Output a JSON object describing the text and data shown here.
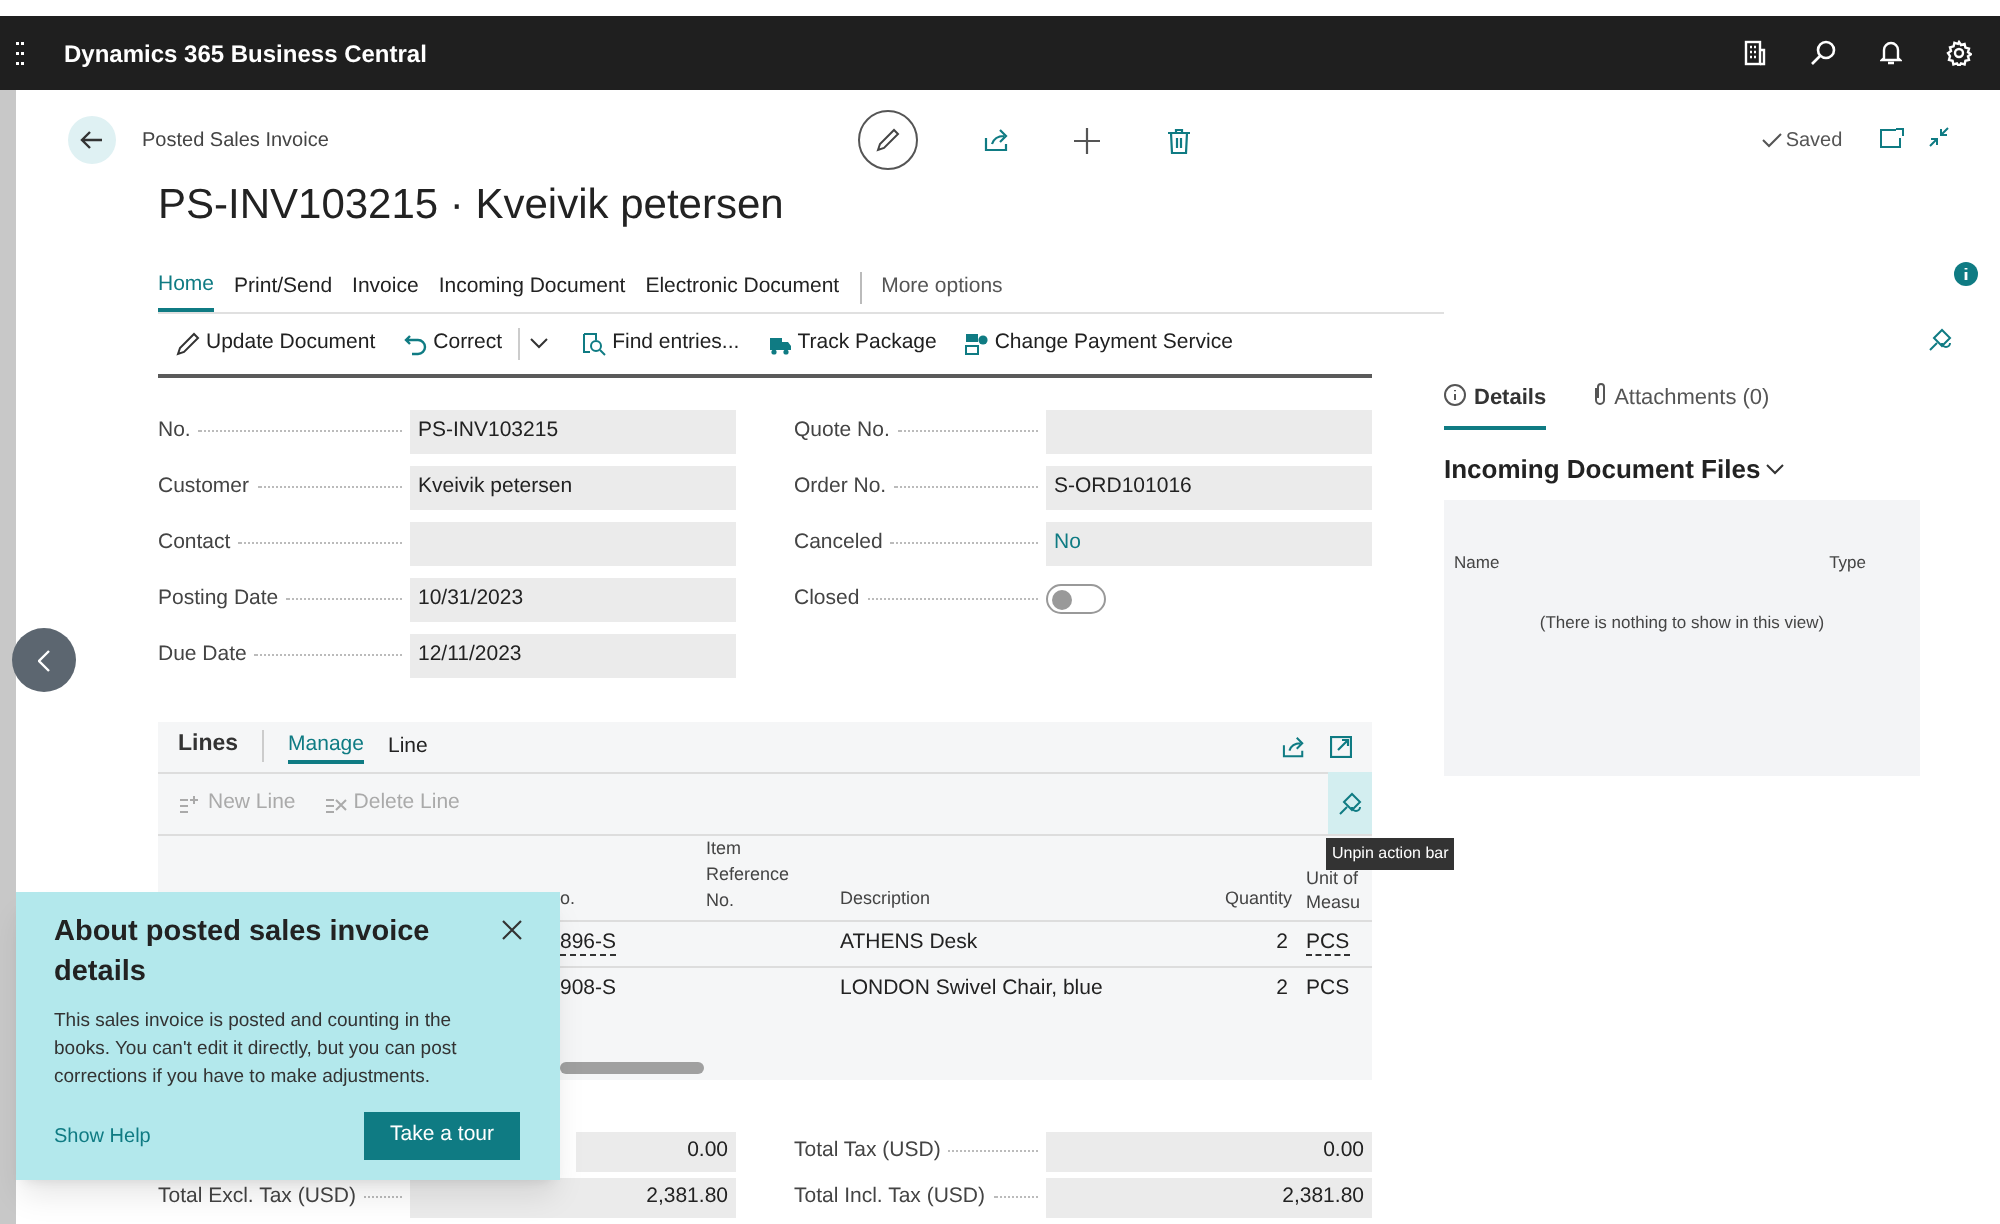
{
  "app": {
    "title": "Dynamics 365 Business Central"
  },
  "header": {
    "breadcrumb": "Posted Sales Invoice",
    "title": "PS-INV103215 · Kveivik petersen",
    "saved": "Saved"
  },
  "tabs": [
    {
      "label": "Home",
      "selected": true
    },
    {
      "label": "Print/Send",
      "selected": false
    },
    {
      "label": "Invoice",
      "selected": false
    },
    {
      "label": "Incoming Document",
      "selected": false
    },
    {
      "label": "Electronic Document",
      "selected": false
    }
  ],
  "more": "More options",
  "actions": [
    {
      "label": "Update Document",
      "kind": "edit"
    },
    {
      "label": "Correct",
      "kind": "split"
    },
    {
      "label": "Find entries...",
      "kind": "find"
    },
    {
      "label": "Track Package",
      "kind": "truck"
    },
    {
      "label": "Change Payment Service",
      "kind": "payment"
    }
  ],
  "fields_left": [
    {
      "label": "No.",
      "value": "PS-INV103215"
    },
    {
      "label": "Customer",
      "value": "Kveivik petersen"
    },
    {
      "label": "Contact"
    },
    {
      "label": "Posting Date",
      "value": "10/31/2023"
    },
    {
      "label": "Due Date",
      "value": "12/11/2023"
    }
  ],
  "fields_right": [
    {
      "label": "Quote No.",
      "kind": "text"
    },
    {
      "label": "Order No.",
      "kind": "text",
      "value": "S-ORD101016"
    },
    {
      "label": "Canceled",
      "kind": "link",
      "value": "No"
    },
    {
      "label": "Closed",
      "kind": "toggle",
      "on": false
    }
  ],
  "factbox": {
    "tabs": [
      {
        "label": "Details",
        "selected": true
      },
      {
        "label": "Attachments (0)",
        "selected": false
      }
    ],
    "heading": "Incoming Document Files",
    "columns": [
      "Name",
      "Type"
    ],
    "empty": "(There is nothing to show in this view)"
  },
  "lines": {
    "title": "Lines",
    "tabs": [
      {
        "label": "Manage",
        "selected": true
      },
      {
        "label": "Line",
        "selected": false
      }
    ],
    "actions": [
      {
        "label": "New Line",
        "disabled": true
      },
      {
        "label": "Delete Line",
        "disabled": true
      }
    ],
    "columns": [
      "o.",
      "Item Reference No.",
      "Description",
      "Quantity",
      "Unit of Measu"
    ],
    "rows": [
      {
        "no": "896-S",
        "description": "ATHENS Desk",
        "quantity": "2",
        "unit": "PCS",
        "linked": true
      },
      {
        "no": "908-S",
        "description": "LONDON Swivel Chair, blue",
        "quantity": "2",
        "unit": "PCS",
        "linked": false
      }
    ]
  },
  "tooltip": "Unpin action bar",
  "totals_left": [
    {
      "value": "0.00"
    },
    {
      "label": "Total Excl. Tax (USD)",
      "value": "2,381.80"
    }
  ],
  "totals_right": [
    {
      "label": "Total Tax (USD)",
      "value": "0.00"
    },
    {
      "label": "Total Incl. Tax (USD)",
      "value": "2,381.80"
    }
  ],
  "teaching_tip": {
    "title": "About posted sales invoice details",
    "body": "This sales invoice is posted and counting in the books. You can't edit it directly, but you can post corrections if you have to make adjustments.",
    "link": "Show Help",
    "button": "Take a tour"
  }
}
